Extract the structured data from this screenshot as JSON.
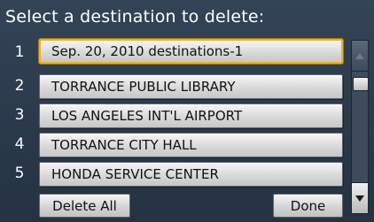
{
  "title": "Select a destination to delete:",
  "rows": [
    {
      "num": "1",
      "label": "Sep. 20, 2010 destinations-1",
      "selected": true
    },
    {
      "num": "2",
      "label": "TORRANCE PUBLIC LIBRARY",
      "selected": false
    },
    {
      "num": "3",
      "label": "LOS ANGELES INT'L AIRPORT",
      "selected": false
    },
    {
      "num": "4",
      "label": "TORRANCE CITY HALL",
      "selected": false
    },
    {
      "num": "5",
      "label": "HONDA SERVICE CENTER",
      "selected": false
    }
  ],
  "buttons": {
    "delete_all": "Delete All",
    "done": "Done"
  },
  "icons": {
    "scroll_up": "triangle-up-icon",
    "scroll_down": "triangle-down-icon"
  },
  "colors": {
    "background": "#2c3b4b",
    "selection_border": "#e8b22a"
  }
}
